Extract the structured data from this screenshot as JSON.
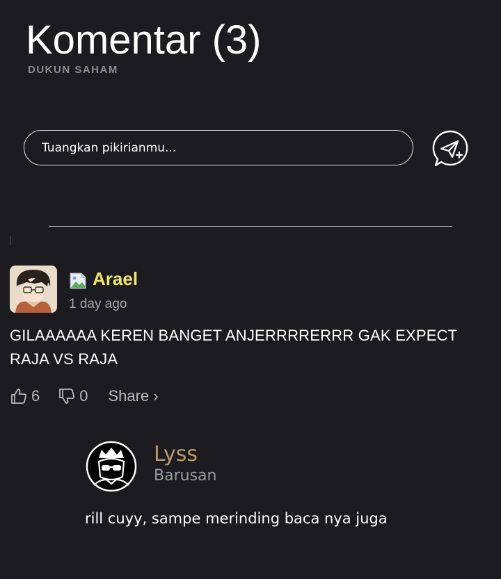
{
  "header": {
    "title": "Komentar (3)",
    "subtitle": "DUKUN SAHAM"
  },
  "composer": {
    "placeholder": "Tuangkan pikirianmu...",
    "send_icon": "send-message-icon"
  },
  "comments": [
    {
      "username": "Arael",
      "username_color": "#efe86a",
      "time": "1 day ago",
      "text": "GILAAAAAA KEREN BANGET ANJERRRRERRR GAK EXPECT RAJA VS RAJA",
      "likes": "6",
      "dislikes": "0",
      "share_label": "Share ›",
      "replies": [
        {
          "username": "Lyss",
          "username_color": "#b99a64",
          "time": "Barusan",
          "text": "rill cuyy, sampe merinding baca nya juga"
        }
      ]
    }
  ],
  "colors": {
    "background": "#1c1b1f",
    "muted": "#a5a5aa"
  }
}
